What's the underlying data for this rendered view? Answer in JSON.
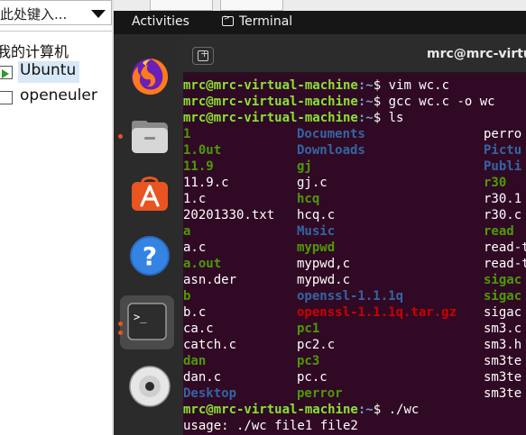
{
  "host": {
    "search_placeholder": "此处键入...",
    "tree": {
      "root": "我的计算机",
      "items": [
        {
          "label": "Ubuntu",
          "selected": true,
          "running": true
        },
        {
          "label": "openeuler",
          "selected": false,
          "running": false
        }
      ]
    }
  },
  "vm": {
    "topbar": {
      "activities": "Activities",
      "app": "Terminal"
    },
    "dock": [
      "firefox-icon",
      "files-icon",
      "software-icon",
      "help-icon",
      "terminal-icon",
      "dvd-icon"
    ],
    "terminal": {
      "title": "mrc@mrc-virtual",
      "prompt_user": "mrc@mrc-virtual-machine",
      "prompt_path": ":~",
      "prompt_symbol": "$ ",
      "commands": [
        "vim wc.c",
        "gcc wc.c -o wc",
        "ls",
        "./wc"
      ],
      "ls_rows": [
        [
          {
            "t": "1",
            "k": "exe"
          },
          {
            "t": "Documents",
            "k": "dir"
          },
          {
            "t": "perro",
            "k": "reg"
          }
        ],
        [
          {
            "t": "1.0ut",
            "k": "exe"
          },
          {
            "t": "Downloads",
            "k": "dir"
          },
          {
            "t": "Pictu",
            "k": "dir"
          }
        ],
        [
          {
            "t": "11.9",
            "k": "exe"
          },
          {
            "t": "gj",
            "k": "exe"
          },
          {
            "t": "Publi",
            "k": "dir"
          }
        ],
        [
          {
            "t": "11.9.c",
            "k": "reg"
          },
          {
            "t": "gj.c",
            "k": "reg"
          },
          {
            "t": "r30",
            "k": "exe"
          }
        ],
        [
          {
            "t": "1.c",
            "k": "reg"
          },
          {
            "t": "hcq",
            "k": "exe"
          },
          {
            "t": "r30.1",
            "k": "reg"
          }
        ],
        [
          {
            "t": "20201330.txt",
            "k": "reg"
          },
          {
            "t": "hcq.c",
            "k": "reg"
          },
          {
            "t": "r30.c",
            "k": "reg"
          }
        ],
        [
          {
            "t": "a",
            "k": "exe"
          },
          {
            "t": "Music",
            "k": "dir"
          },
          {
            "t": "read",
            "k": "exe"
          }
        ],
        [
          {
            "t": "a.c",
            "k": "reg"
          },
          {
            "t": "mypwd",
            "k": "exe"
          },
          {
            "t": "read-t",
            "k": "reg"
          }
        ],
        [
          {
            "t": "a.out",
            "k": "exe"
          },
          {
            "t": "mypwd,c",
            "k": "reg"
          },
          {
            "t": "read-t",
            "k": "reg"
          }
        ],
        [
          {
            "t": "asn.der",
            "k": "reg"
          },
          {
            "t": "mypwd.c",
            "k": "reg"
          },
          {
            "t": "sigac",
            "k": "exe"
          }
        ],
        [
          {
            "t": "b",
            "k": "exe"
          },
          {
            "t": "openssl-1.1.1q",
            "k": "dir"
          },
          {
            "t": "sigac",
            "k": "exe"
          }
        ],
        [
          {
            "t": "b.c",
            "k": "reg"
          },
          {
            "t": "openssl-1.1.1q.tar.gz",
            "k": "arc"
          },
          {
            "t": "sigac",
            "k": "reg"
          }
        ],
        [
          {
            "t": "ca.c",
            "k": "reg"
          },
          {
            "t": "pc1",
            "k": "exe"
          },
          {
            "t": "sm3.c",
            "k": "reg"
          }
        ],
        [
          {
            "t": "catch.c",
            "k": "reg"
          },
          {
            "t": "pc2.c",
            "k": "reg"
          },
          {
            "t": "sm3.h",
            "k": "reg"
          }
        ],
        [
          {
            "t": "dan",
            "k": "exe"
          },
          {
            "t": "pc3",
            "k": "exe"
          },
          {
            "t": "sm3te",
            "k": "reg"
          }
        ],
        [
          {
            "t": "dan.c",
            "k": "reg"
          },
          {
            "t": "pc.c",
            "k": "reg"
          },
          {
            "t": "sm3te",
            "k": "reg"
          }
        ],
        [
          {
            "t": "Desktop",
            "k": "dir"
          },
          {
            "t": "perror",
            "k": "exe"
          },
          {
            "t": "sm3te",
            "k": "reg"
          }
        ]
      ],
      "output_last": "usage: ./wc file1 file2"
    }
  },
  "colors": {
    "terminal_bg": "#300a24",
    "prompt_user": "#8ae234",
    "prompt_path": "#729fcf",
    "dir": "#3465a4",
    "exe": "#4e9a06",
    "archive": "#cc0000",
    "accent": "#e95420"
  }
}
